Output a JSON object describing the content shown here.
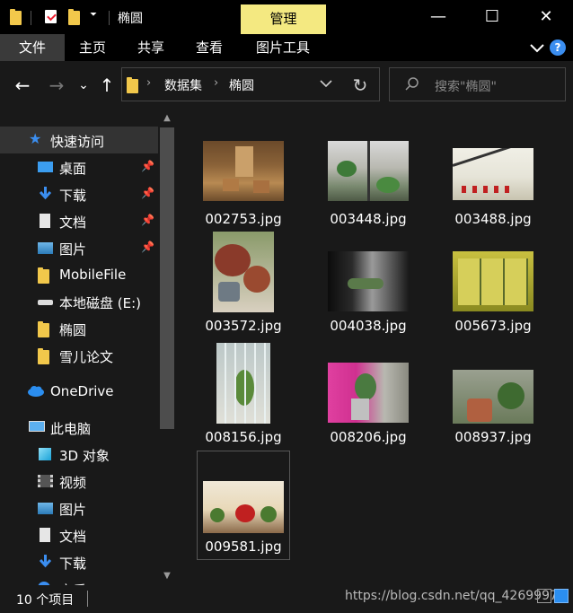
{
  "titlebar": {
    "title": "椭圆",
    "manage_tab": "管理",
    "minimize_glyph": "—",
    "maximize_glyph": "☐",
    "close_glyph": "✕"
  },
  "ribbon": {
    "tabs": [
      "文件",
      "主页",
      "共享",
      "查看",
      "图片工具"
    ]
  },
  "nav": {
    "back": "←",
    "forward": "→",
    "recent": "⌄",
    "up": "↑",
    "breadcrumbs": [
      "数据集",
      "椭圆"
    ],
    "refresh": "↻",
    "search_placeholder": "搜索\"椭圆\""
  },
  "sidebar": {
    "items": [
      {
        "label": "快速访问",
        "icon": "star-icon",
        "pinned": false
      },
      {
        "label": "桌面",
        "icon": "desktop-icon",
        "pinned": true
      },
      {
        "label": "下载",
        "icon": "download-arrow-icon",
        "pinned": true
      },
      {
        "label": "文档",
        "icon": "document-icon",
        "pinned": true
      },
      {
        "label": "图片",
        "icon": "pictures-icon",
        "pinned": true
      },
      {
        "label": "MobileFile",
        "icon": "folder-icon",
        "pinned": false
      },
      {
        "label": "本地磁盘 (E:)",
        "icon": "drive-icon",
        "pinned": false
      },
      {
        "label": "椭圆",
        "icon": "folder-icon",
        "pinned": false
      },
      {
        "label": "雪儿论文",
        "icon": "folder-icon",
        "pinned": false
      },
      {
        "label": "OneDrive",
        "icon": "cloud-icon",
        "pinned": false
      },
      {
        "label": "此电脑",
        "icon": "computer-icon",
        "pinned": false
      },
      {
        "label": "3D 对象",
        "icon": "cube-3d-icon",
        "pinned": false
      },
      {
        "label": "视频",
        "icon": "video-icon",
        "pinned": false
      },
      {
        "label": "图片",
        "icon": "pictures-icon",
        "pinned": false
      },
      {
        "label": "文档",
        "icon": "document-icon",
        "pinned": false
      },
      {
        "label": "下载",
        "icon": "download-arrow-icon",
        "pinned": false
      },
      {
        "label": "音乐",
        "icon": "music-icon",
        "pinned": false
      }
    ]
  },
  "files": [
    {
      "name": "002753.jpg"
    },
    {
      "name": "003448.jpg"
    },
    {
      "name": "003488.jpg"
    },
    {
      "name": "003572.jpg"
    },
    {
      "name": "004038.jpg"
    },
    {
      "name": "005673.jpg"
    },
    {
      "name": "008156.jpg"
    },
    {
      "name": "008206.jpg"
    },
    {
      "name": "008937.jpg"
    },
    {
      "name": "009581.jpg"
    }
  ],
  "status": {
    "count": "10 个项目",
    "watermark": "https://blog.csdn.net/qq_42699972"
  },
  "colors": {
    "background": "#191919",
    "titlebar": "#000000",
    "manage_tab": "#f4e981",
    "folder": "#f2c84b",
    "accent_blue": "#3b8ef0"
  }
}
